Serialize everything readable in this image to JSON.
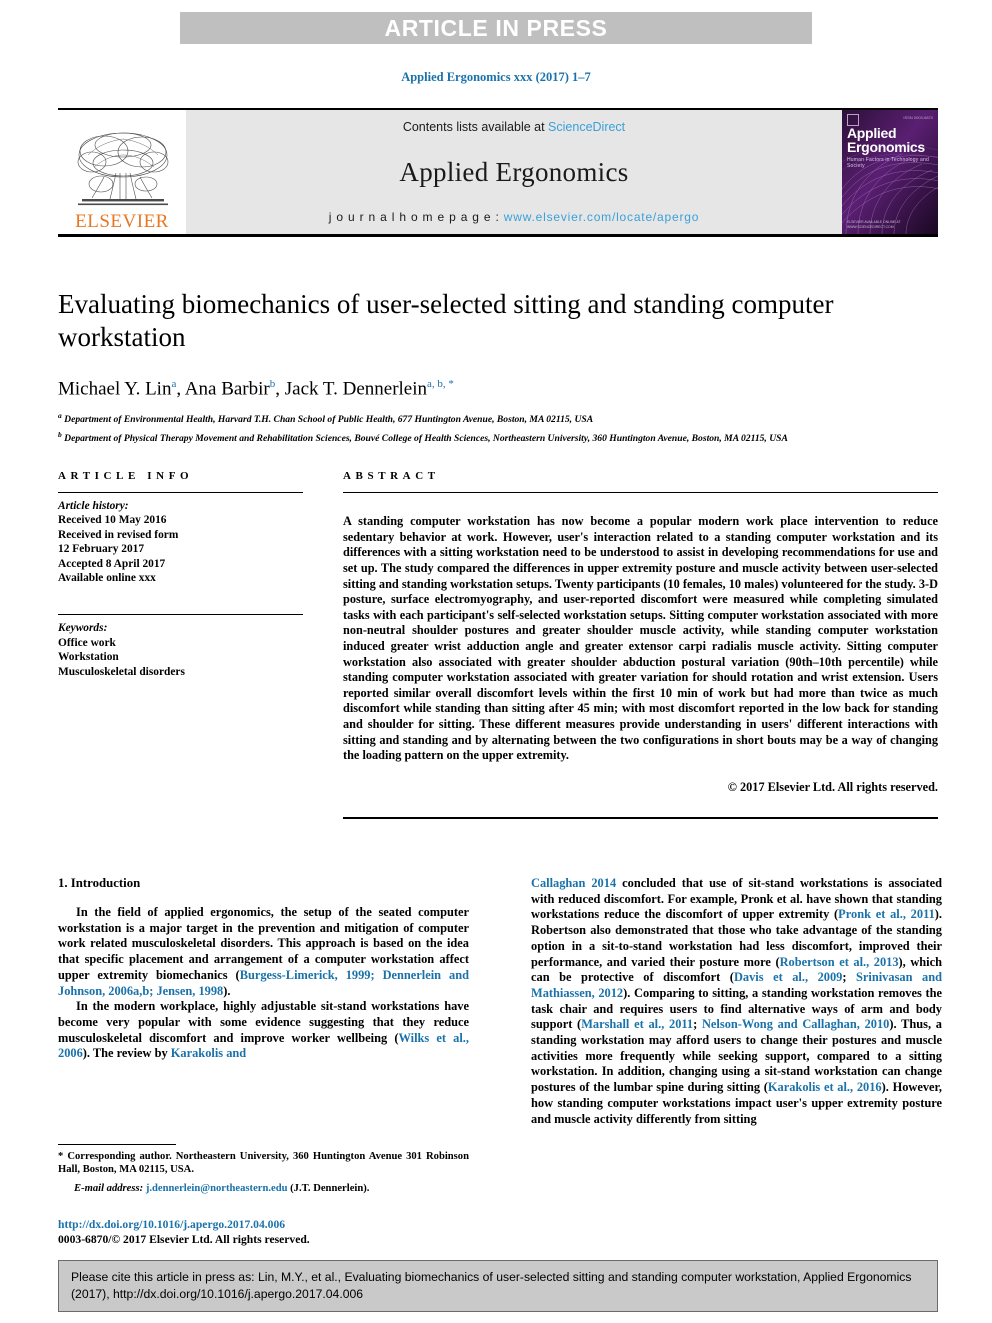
{
  "banner": {
    "text": "ARTICLE IN PRESS"
  },
  "running_head": "Applied Ergonomics xxx (2017) 1–7",
  "masthead": {
    "contents_prefix": "Contents lists available at ",
    "contents_link": "ScienceDirect",
    "journal_name": "Applied Ergonomics",
    "homepage_prefix": "j o u r n a l   h o m e p a g e :  ",
    "homepage_url": "www.elsevier.com/locate/apergo",
    "publisher": "ELSEVIER",
    "cover": {
      "title_line1": "Applied",
      "title_line2": "Ergonomics",
      "subtitle": "Human Factors in Technology and Society",
      "corner": "ISSN 0003-6870",
      "footer": "ELSEVIER\nAVAILABLE ONLINE AT WWW.SCIENCEDIRECT.COM"
    }
  },
  "article": {
    "title": "Evaluating biomechanics of user-selected sitting and standing computer workstation",
    "authors": [
      {
        "name": "Michael Y. Lin",
        "marks": "a"
      },
      {
        "name": "Ana Barbir",
        "marks": "b"
      },
      {
        "name": "Jack T. Dennerlein",
        "marks": "a, b, *"
      }
    ],
    "affiliations": [
      {
        "mark": "a",
        "text": "Department of Environmental Health, Harvard T.H. Chan School of Public Health, 677 Huntington Avenue, Boston, MA 02115, USA"
      },
      {
        "mark": "b",
        "text": "Department of Physical Therapy Movement and Rehabilitation Sciences, Bouvé College of Health Sciences, Northeastern University, 360 Huntington Avenue, Boston, MA 02115, USA"
      }
    ]
  },
  "article_info": {
    "label": "ARTICLE INFO",
    "history_label": "Article history:",
    "history": [
      "Received 10 May 2016",
      "Received in revised form",
      "12 February 2017",
      "Accepted 8 April 2017",
      "Available online xxx"
    ],
    "keywords_label": "Keywords:",
    "keywords": [
      "Office work",
      "Workstation",
      "Musculoskeletal disorders"
    ]
  },
  "abstract": {
    "label": "ABSTRACT",
    "text": "A standing computer workstation has now become a popular modern work place intervention to reduce sedentary behavior at work. However, user's interaction related to a standing computer workstation and its differences with a sitting workstation need to be understood to assist in developing recommendations for use and set up. The study compared the differences in upper extremity posture and muscle activity between user-selected sitting and standing workstation setups. Twenty participants (10 females, 10 males) volunteered for the study. 3-D posture, surface electromyography, and user-reported discomfort were measured while completing simulated tasks with each participant's self-selected workstation setups. Sitting computer workstation associated with more non-neutral shoulder postures and greater shoulder muscle activity, while standing computer workstation induced greater wrist adduction angle and greater extensor carpi radialis muscle activity. Sitting computer workstation also associated with greater shoulder abduction postural variation (90th–10th percentile) while standing computer workstation associated with greater variation for should rotation and wrist extension. Users reported similar overall discomfort levels within the first 10 min of work but had more than twice as much discomfort while standing than sitting after 45 min; with most discomfort reported in the low back for standing and shoulder for sitting. These different measures provide understanding in users' different interactions with sitting and standing and by alternating between the two configurations in short bouts may be a way of changing the loading pattern on the upper extremity.",
    "copyright": "© 2017 Elsevier Ltd. All rights reserved."
  },
  "introduction": {
    "heading": "1. Introduction",
    "left_paragraphs": [
      {
        "segments": [
          {
            "t": "In the field of applied ergonomics, the setup of the seated computer workstation is a major target in the prevention and mitigation of computer work related musculoskeletal disorders. This approach is based on the idea that specific placement and arrangement of a computer workstation affect upper extremity biomechanics (",
            "link": false
          },
          {
            "t": "Burgess-Limerick, 1999; Dennerlein and Johnson, 2006a,b; Jensen, 1998",
            "link": true
          },
          {
            "t": ").",
            "link": false
          }
        ]
      },
      {
        "segments": [
          {
            "t": "In the modern workplace, highly adjustable sit-stand workstations have become very popular with some evidence suggesting that they reduce musculoskeletal discomfort and improve worker wellbeing (",
            "link": false
          },
          {
            "t": "Wilks et al., 2006",
            "link": true
          },
          {
            "t": "). The review by ",
            "link": false
          },
          {
            "t": "Karakolis and",
            "link": true
          }
        ]
      }
    ],
    "right_paragraphs": [
      {
        "segments": [
          {
            "t": "Callaghan 2014",
            "link": true
          },
          {
            "t": " concluded that use of sit-stand workstations is associated with reduced discomfort. For example, Pronk et al. have shown that standing workstations reduce the discomfort of upper extremity (",
            "link": false
          },
          {
            "t": "Pronk et al., 2011",
            "link": true
          },
          {
            "t": "). Robertson also demonstrated that those who take advantage of the standing option in a sit-to-stand workstation had less discomfort, improved their performance, and varied their posture more (",
            "link": false
          },
          {
            "t": "Robertson et al., 2013",
            "link": true
          },
          {
            "t": "), which can be protective of discomfort (",
            "link": false
          },
          {
            "t": "Davis et al., 2009",
            "link": true
          },
          {
            "t": "; ",
            "link": false
          },
          {
            "t": "Srinivasan and Mathiassen, 2012",
            "link": true
          },
          {
            "t": "). Comparing to sitting, a standing workstation removes the task chair and requires users to find alternative ways of arm and body support (",
            "link": false
          },
          {
            "t": "Marshall et al., 2011",
            "link": true
          },
          {
            "t": "; ",
            "link": false
          },
          {
            "t": "Nelson-Wong and Callaghan, 2010",
            "link": true
          },
          {
            "t": "). Thus, a standing workstation may afford users to change their postures and muscle activities more frequently while seeking support, compared to a sitting workstation. In addition, changing using a sit-stand workstation can change postures of the lumbar spine during sitting (",
            "link": false
          },
          {
            "t": "Karakolis et al., 2016",
            "link": true
          },
          {
            "t": "). However, how standing computer workstations impact user's upper extremity posture and muscle activity differently from sitting",
            "link": false
          }
        ]
      }
    ]
  },
  "footnotes": {
    "corresponding": "* Corresponding author. Northeastern University, 360 Huntington Avenue 301 Robinson Hall, Boston, MA 02115, USA.",
    "email_label": "E-mail address:",
    "email": "j.dennerlein@northeastern.edu",
    "email_suffix": "(J.T. Dennerlein)."
  },
  "doi": {
    "url": "http://dx.doi.org/10.1016/j.apergo.2017.04.006",
    "issn_line": "0003-6870/© 2017 Elsevier Ltd. All rights reserved."
  },
  "cite_box": {
    "text": "Please cite this article in press as: Lin, M.Y., et al., Evaluating biomechanics of user-selected sitting and standing computer workstation, Applied Ergonomics (2017), http://dx.doi.org/10.1016/j.apergo.2017.04.006"
  }
}
